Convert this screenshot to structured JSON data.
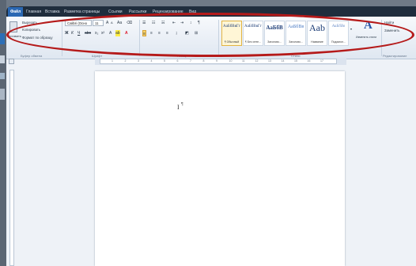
{
  "tabs": [
    "Файл",
    "Главная",
    "Вставка",
    "Разметка страницы",
    "Ссылки",
    "Рассылки",
    "Рецензирование",
    "Вид"
  ],
  "clipboard": {
    "paste_label": "Вставить",
    "cut_label": "Вырезать",
    "copy_label": "Копировать",
    "format_painter_label": "Формат по образцу",
    "group_label": "Буфер обмена"
  },
  "font": {
    "name": "Calibri (Осно",
    "size": "11",
    "group_label": "Шрифт"
  },
  "paragraph": {
    "group_label": "Абзац"
  },
  "styles": {
    "group_label": "Стили",
    "items": [
      {
        "sample": "AaБбВвГг",
        "name": "¶ Обычный"
      },
      {
        "sample": "AaБбВвГг",
        "name": "¶ Без инте..."
      },
      {
        "sample": "AaБбВ",
        "name": "Заголово..."
      },
      {
        "sample": "AaБбВв",
        "name": "Заголово..."
      },
      {
        "sample": "Aab",
        "name": "Название"
      },
      {
        "sample": "AaБбВв",
        "name": "Подзагол..."
      }
    ],
    "change_styles_label": "Изменить стили"
  },
  "editing": {
    "find_label": "Найти",
    "replace_label": "Заменить",
    "group_label": "Редактирование"
  },
  "ruler_numbers": [
    "1",
    "2",
    "3",
    "4",
    "5",
    "6",
    "7",
    "8",
    "9",
    "10",
    "11",
    "12",
    "13",
    "14",
    "15",
    "16",
    "17"
  ],
  "document": {
    "cursor_glyph": "I",
    "paragraph_mark": "¶"
  },
  "colors": {
    "annotation": "#b51a1a",
    "file_tab": "#2b68b3"
  }
}
